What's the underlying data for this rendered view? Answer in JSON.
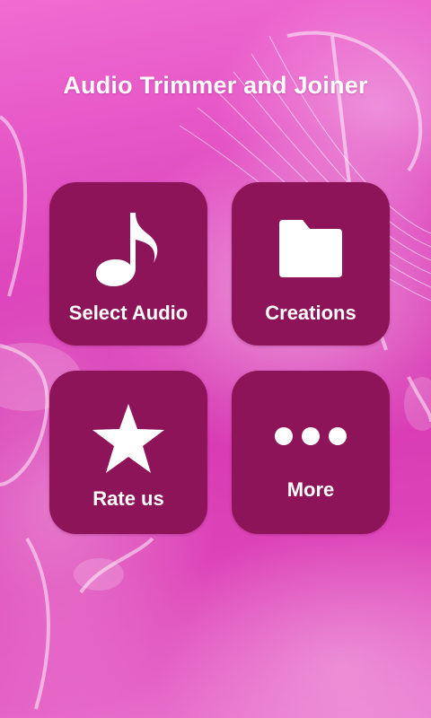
{
  "app": {
    "title": "Audio Trimmer and Joiner"
  },
  "menu": [
    {
      "label": "Select Audio",
      "icon": "music-note-icon"
    },
    {
      "label": "Creations",
      "icon": "folder-icon"
    },
    {
      "label": "Rate us",
      "icon": "star-icon"
    },
    {
      "label": "More",
      "icon": "more-dots-icon"
    }
  ],
  "colors": {
    "tile_background": "#8e1459",
    "background_pink": "#e04cc0",
    "text": "#ffffff"
  }
}
